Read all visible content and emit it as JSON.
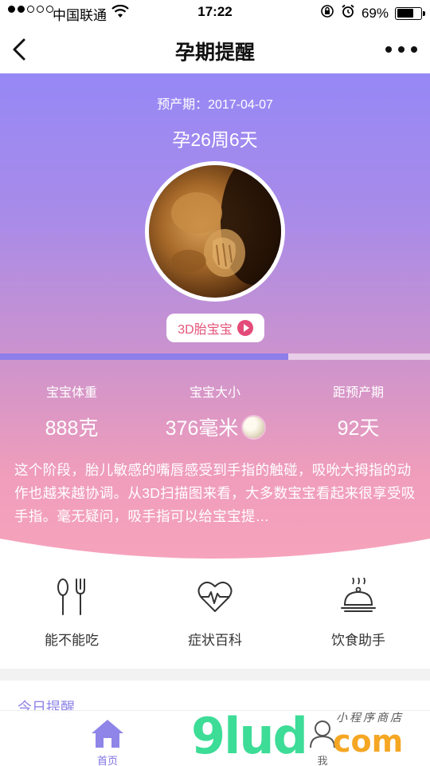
{
  "status_bar": {
    "carrier": "中国联通",
    "time": "17:22",
    "battery_text": "69%",
    "battery_level": 0.69
  },
  "nav": {
    "title": "孕期提醒"
  },
  "hero": {
    "due_date": "预产期：2017-04-07",
    "gestational_age": "孕26周6天",
    "button_3d": "3D胎宝宝",
    "progress": 0.67
  },
  "stats": [
    {
      "label": "宝宝体重",
      "value": "888克"
    },
    {
      "label": "宝宝大小",
      "value": "376毫米"
    },
    {
      "label": "距预产期",
      "value": "92天"
    }
  ],
  "description": "这个阶段，胎儿敏感的嘴唇感受到手指的触碰，吸吮大拇指的动作也越来越协调。从3D扫描图来看，大多数宝宝看起来很享受吸手指。毫无疑问，吸手指可以给宝宝提…",
  "tools": [
    {
      "label": "能不能吃",
      "icon": "utensils-icon"
    },
    {
      "label": "症状百科",
      "icon": "heartbeat-icon"
    },
    {
      "label": "饮食助手",
      "icon": "food-cloche-icon"
    }
  ],
  "today": {
    "label": "今日提醒"
  },
  "tab_bar": {
    "home": "首页",
    "me": "我"
  },
  "watermark": {
    "main": "9lud",
    "com": "com",
    "sub": "小程序商店"
  },
  "colors": {
    "accent": "#8f84e8",
    "pink": "#e4557a",
    "hero_top": "#9688f6",
    "hero_bottom": "#f6a3bd"
  }
}
